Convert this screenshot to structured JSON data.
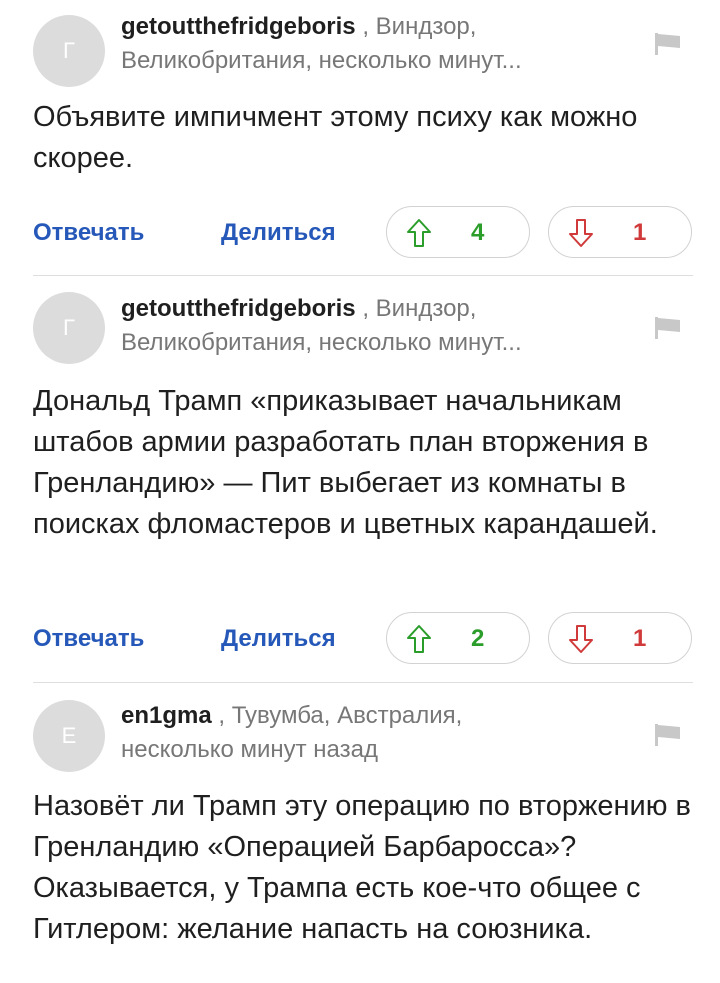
{
  "comments": [
    {
      "avatar_letter": "Г",
      "author": "getoutthefridgeboris",
      "meta_line1": " , Виндзор,",
      "meta_line2": "Великобритания, несколько минут...",
      "text": "Объявите импичмент этому психу как можно скорее.",
      "reply_label": "Отвечать",
      "share_label": "Делиться",
      "upvotes": "4",
      "downvotes": "1"
    },
    {
      "avatar_letter": "Г",
      "author": "getoutthefridgeboris",
      "meta_line1": " , Виндзор,",
      "meta_line2": "Великобритания, несколько минут...",
      "text": "Дональд Трамп «приказывает начальникам штабов армии разработать план вторжения в Гренландию» — Пит выбегает из комнаты в поисках фломастеров и цветных карандашей.",
      "reply_label": "Отвечать",
      "share_label": "Делиться",
      "upvotes": "2",
      "downvotes": "1"
    },
    {
      "avatar_letter": "E",
      "author": "en1gma",
      "meta_line1": " , Тувумба, Австралия,",
      "meta_line2": "несколько минут назад",
      "text": "Назовёт ли Трамп эту операцию по вторжению в Гренландию «Операцией Барбаросса»? Оказывается, у Трампа есть кое-что общее с Гитлером: желание напасть на союзника."
    }
  ],
  "icons": {
    "flag": "flag-icon",
    "upvote": "arrow-up-icon",
    "downvote": "arrow-down-icon"
  },
  "colors": {
    "link": "#2558b8",
    "upvote": "#2a9d2a",
    "downvote": "#d03a3a",
    "avatar_bg": "#dcdcdc"
  }
}
